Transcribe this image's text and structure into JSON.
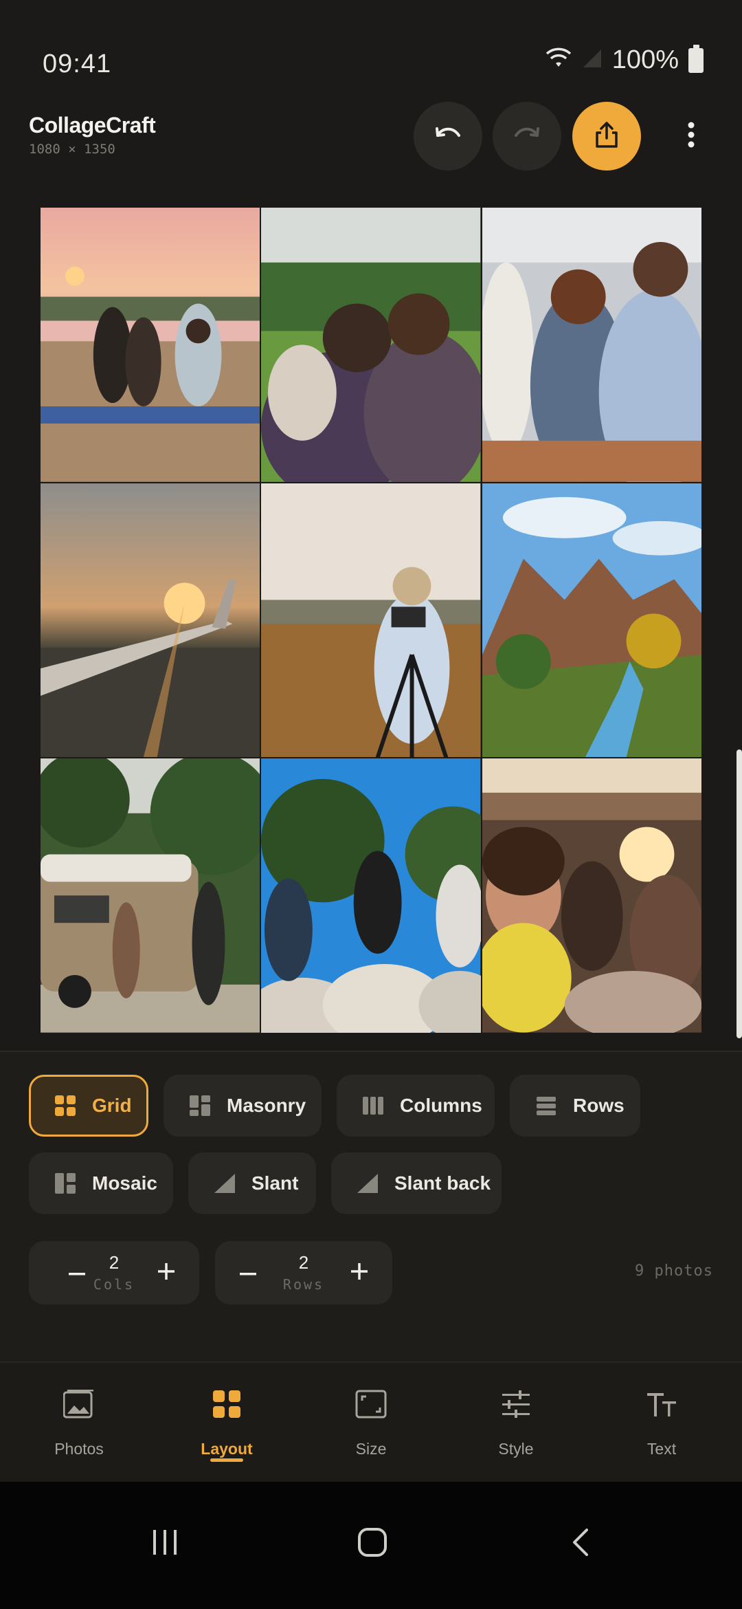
{
  "status": {
    "time": "09:41",
    "battery": "100%"
  },
  "app": {
    "title": "CollageCraft",
    "dimensions": "1080 × 1350"
  },
  "photos": [
    "beach-sunset-friends",
    "couple-outdoors",
    "three-friends-sitting",
    "airplane-wing-sunset",
    "photographer-field",
    "canyon-river",
    "van-camping",
    "friends-on-rocks",
    "friends-in-car"
  ],
  "layouts": {
    "row1": [
      {
        "label": "Grid",
        "icon": "grid-icon",
        "active": true
      },
      {
        "label": "Masonry",
        "icon": "masonry-icon",
        "active": false
      },
      {
        "label": "Columns",
        "icon": "columns-icon",
        "active": false
      },
      {
        "label": "Rows",
        "icon": "rows-icon",
        "active": false
      }
    ],
    "row2": [
      {
        "label": "Mosaic",
        "icon": "mosaic-icon",
        "active": false
      },
      {
        "label": "Slant",
        "icon": "slant-icon",
        "active": false
      },
      {
        "label": "Slant back",
        "icon": "slant-back-icon",
        "active": false
      }
    ]
  },
  "cols": {
    "value": "2",
    "label": "Cols"
  },
  "rows": {
    "value": "2",
    "label": "Rows"
  },
  "photo_count": "9 photos",
  "nav": [
    {
      "label": "Photos",
      "icon": "photos-icon"
    },
    {
      "label": "Layout",
      "icon": "layout-icon"
    },
    {
      "label": "Size",
      "icon": "size-icon"
    },
    {
      "label": "Style",
      "icon": "style-icon"
    },
    {
      "label": "Text",
      "icon": "text-icon"
    }
  ],
  "colors": {
    "accent": "#f0a93b",
    "background": "#1b1a18",
    "panel": "#1f1d1a",
    "chip": "#2a2824"
  }
}
